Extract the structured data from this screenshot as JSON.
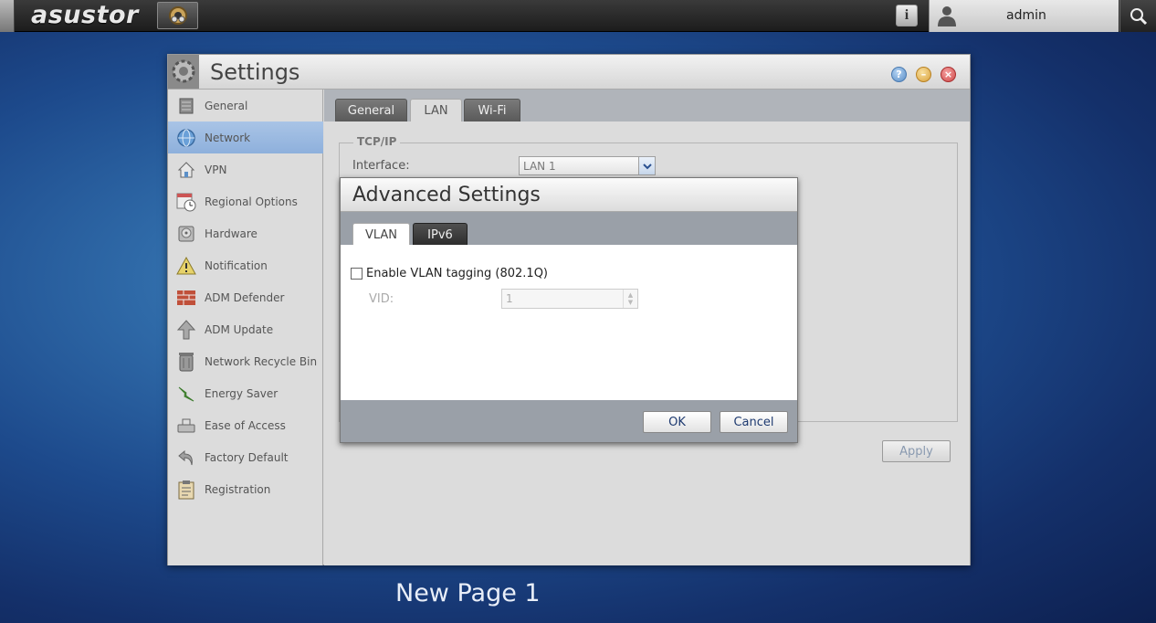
{
  "topbar": {
    "logo": "asustor",
    "info_icon": "info-icon",
    "user_name": "admin",
    "search_icon": "search-icon"
  },
  "window": {
    "title": "Settings",
    "controls": [
      "help-icon",
      "minimize-icon",
      "close-icon"
    ]
  },
  "sidebar": {
    "items": [
      {
        "label": "General",
        "icon": "server-icon"
      },
      {
        "label": "Network",
        "icon": "globe-icon",
        "active": true
      },
      {
        "label": "VPN",
        "icon": "house-icon"
      },
      {
        "label": "Regional Options",
        "icon": "calendar-clock-icon"
      },
      {
        "label": "Hardware",
        "icon": "harddrive-icon"
      },
      {
        "label": "Notification",
        "icon": "warning-icon"
      },
      {
        "label": "ADM Defender",
        "icon": "firewall-icon"
      },
      {
        "label": "ADM Update",
        "icon": "upload-arrow-icon"
      },
      {
        "label": "Network Recycle Bin",
        "icon": "trash-icon"
      },
      {
        "label": "Energy Saver",
        "icon": "lightning-icon"
      },
      {
        "label": "Ease of Access",
        "icon": "ease-access-icon"
      },
      {
        "label": "Factory Default",
        "icon": "undo-icon"
      },
      {
        "label": "Registration",
        "icon": "clipboard-icon"
      }
    ]
  },
  "tabs": [
    "General",
    "LAN",
    "Wi-Fi"
  ],
  "active_tab": "LAN",
  "tcpip": {
    "legend": "TCP/IP",
    "interface_label": "Interface:",
    "interface_value": "LAN 1"
  },
  "apply_label": "Apply",
  "modal": {
    "title": "Advanced Settings",
    "tabs": [
      "VLAN",
      "IPv6"
    ],
    "active_tab": "VLAN",
    "vlan_checkbox_label": "Enable VLAN tagging (802.1Q)",
    "vlan_checked": false,
    "vid_label": "VID:",
    "vid_value": "1",
    "ok_label": "OK",
    "cancel_label": "Cancel"
  },
  "page_label": "New Page 1",
  "colors": {
    "active_item": "#a9c4e6",
    "accent_blue": "#1e3a70",
    "desktop_blue": "#2f6aa8"
  }
}
